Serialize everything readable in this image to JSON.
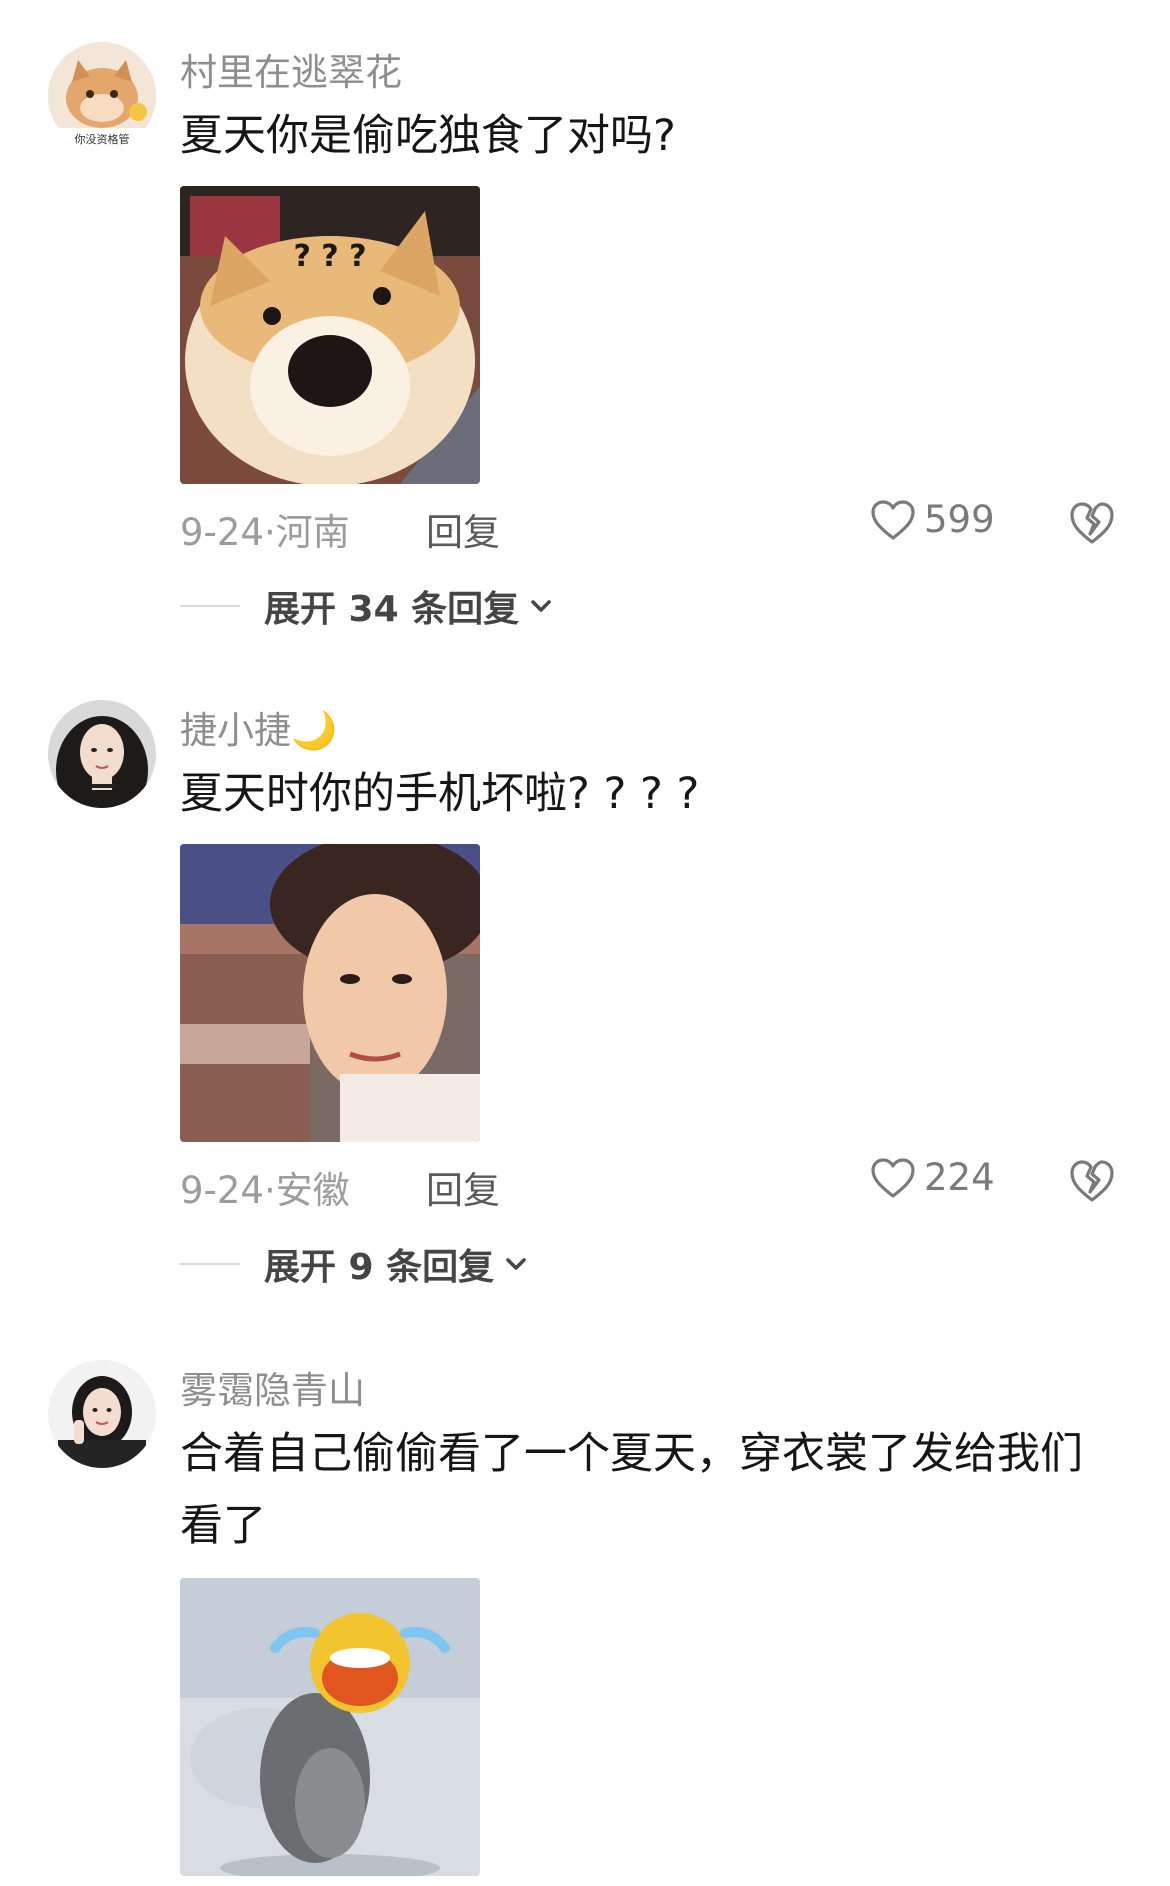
{
  "comments": [
    {
      "username": "村里在逃翠花",
      "avatar_badge": "你没资格管",
      "text": "夏天你是偷吃独食了对吗?",
      "image_overlay": "? ? ?",
      "date_location": "9-24·河南",
      "reply_label": "回复",
      "likes": "599",
      "expand_label": "展开 34 条回复"
    },
    {
      "username": "捷小捷🌙",
      "text": "夏天时你的手机坏啦? ? ? ?",
      "date_location": "9-24·安徽",
      "reply_label": "回复",
      "likes": "224",
      "expand_label": "展开 9 条回复"
    },
    {
      "username": "雾霭隐青山",
      "text": "合着自己偷偷看了一个夏天，穿衣裳了发给我们看了"
    }
  ],
  "icons": {
    "like": "heart-outline-icon",
    "dislike": "broken-heart-icon",
    "expand": "chevron-down-icon"
  }
}
